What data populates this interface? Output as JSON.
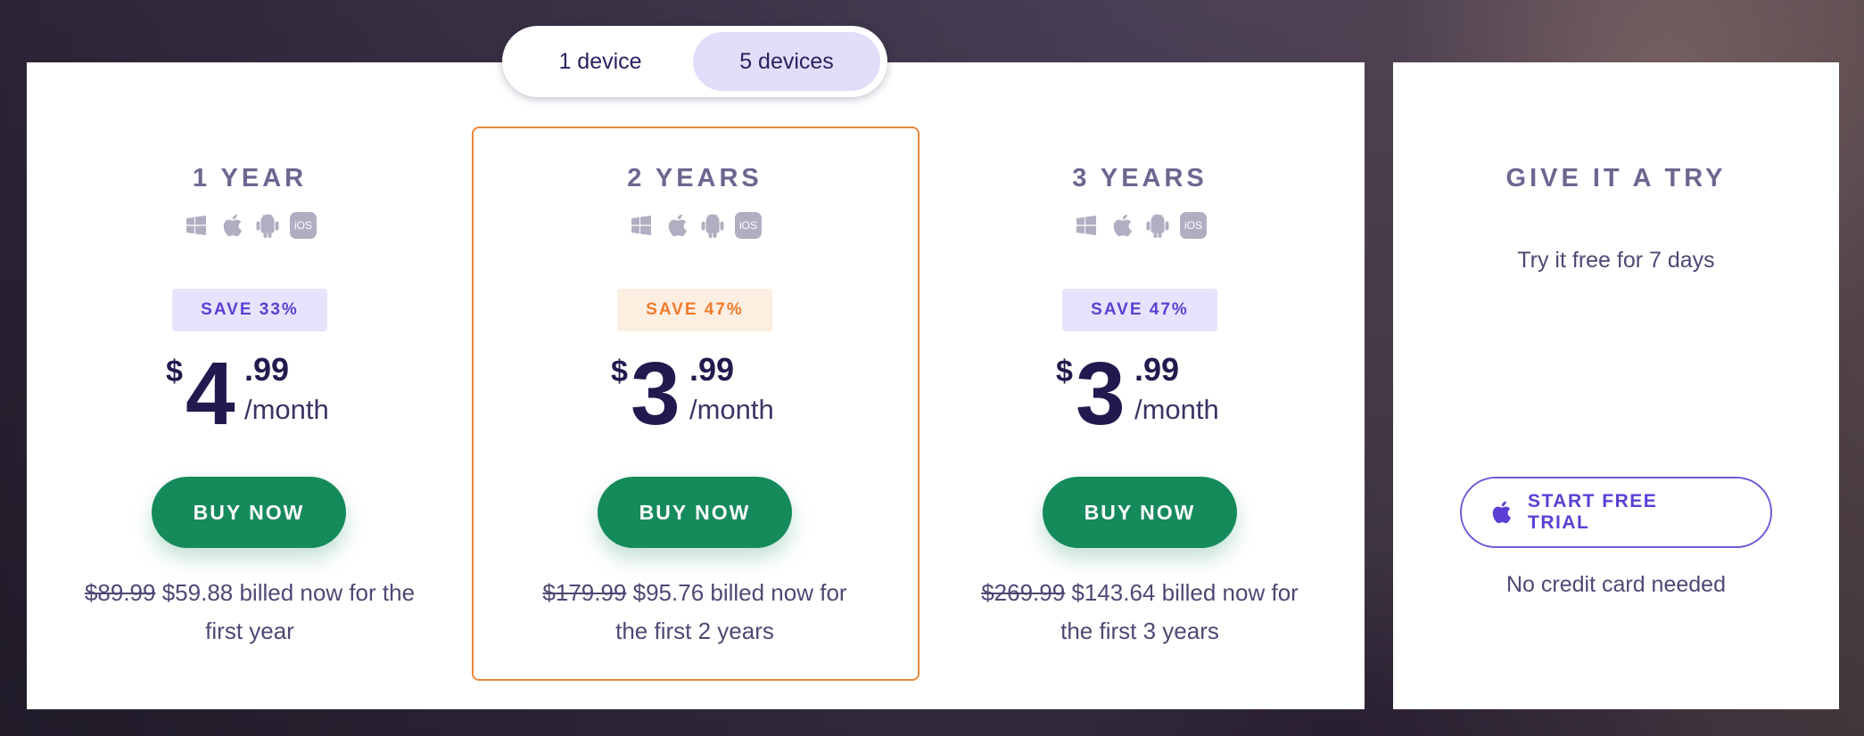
{
  "toggle": {
    "options": [
      "1 device",
      "5 devices"
    ],
    "selected": "5 devices"
  },
  "plans": [
    {
      "title": "1 YEAR",
      "platforms": [
        "windows-icon",
        "apple-icon",
        "android-icon",
        "iOS"
      ],
      "save": "SAVE 33%",
      "price": {
        "currency": "$",
        "dollars": "4",
        "cents": ".99",
        "period": "/month"
      },
      "buy": "BUY NOW",
      "old_price": "$89.99",
      "billed": "$59.88 billed now for the first year",
      "highlighted": false
    },
    {
      "title": "2 YEARS",
      "platforms": [
        "windows-icon",
        "apple-icon",
        "android-icon",
        "iOS"
      ],
      "save": "SAVE 47%",
      "price": {
        "currency": "$",
        "dollars": "3",
        "cents": ".99",
        "period": "/month"
      },
      "buy": "BUY NOW",
      "old_price": "$179.99",
      "billed": "$95.76 billed now for the first 2 years",
      "highlighted": true
    },
    {
      "title": "3 YEARS",
      "platforms": [
        "windows-icon",
        "apple-icon",
        "android-icon",
        "iOS"
      ],
      "save": "SAVE 47%",
      "price": {
        "currency": "$",
        "dollars": "3",
        "cents": ".99",
        "period": "/month"
      },
      "buy": "BUY NOW",
      "old_price": "$269.99",
      "billed": "$143.64 billed now for the first 3 years",
      "highlighted": false
    }
  ],
  "trial": {
    "title": "GIVE IT A TRY",
    "subtitle": "Try it free for 7 days",
    "button": "START FREE TRIAL",
    "note": "No credit card needed"
  },
  "colors": {
    "accent_purple": "#5b3fd3",
    "accent_orange": "#ef7b2a",
    "buy_green": "#158a5b",
    "price_navy": "#24194f"
  }
}
